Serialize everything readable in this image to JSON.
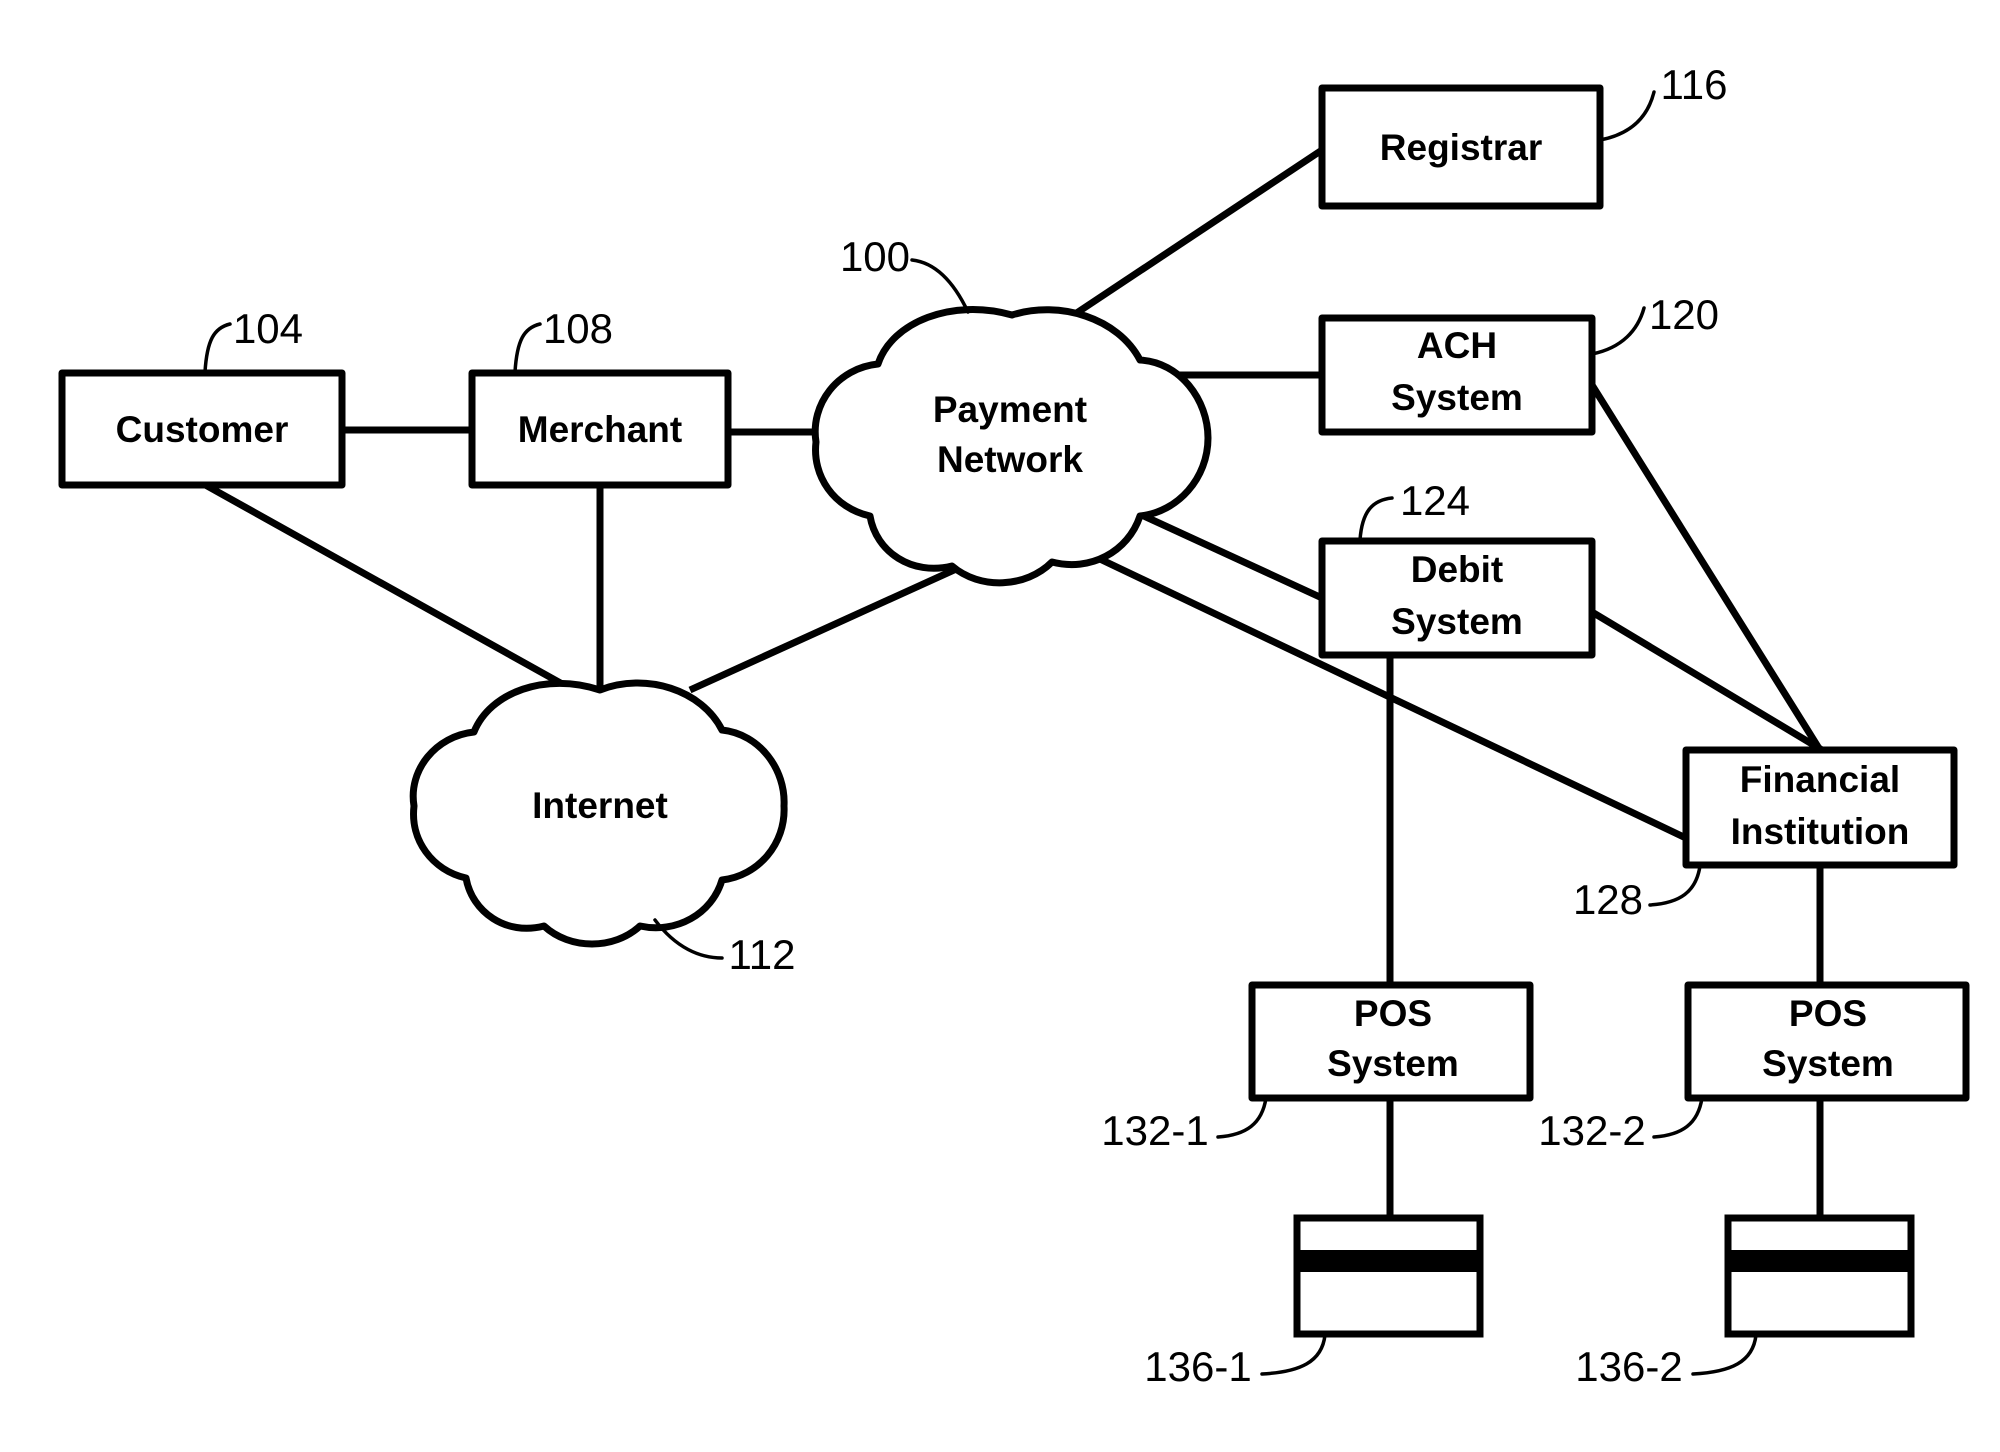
{
  "figure": {
    "title": "Payment network system block diagram",
    "background_color": "#ffffff",
    "line_color": "#000000"
  },
  "nodes": [
    {
      "id": "customer",
      "label": "Customer",
      "shape": "rect",
      "ref": "104"
    },
    {
      "id": "merchant",
      "label": "Merchant",
      "shape": "rect",
      "ref": "108"
    },
    {
      "id": "payment_network",
      "label_line1": "Payment",
      "label_line2": "Network",
      "shape": "cloud",
      "ref": "100"
    },
    {
      "id": "internet",
      "label": "Internet",
      "shape": "cloud",
      "ref": "112"
    },
    {
      "id": "registrar",
      "label": "Registrar",
      "shape": "rect",
      "ref": "116"
    },
    {
      "id": "ach_system",
      "label_line1": "ACH",
      "label_line2": "System",
      "shape": "rect",
      "ref": "120"
    },
    {
      "id": "debit_system",
      "label_line1": "Debit",
      "label_line2": "System",
      "shape": "rect",
      "ref": "124"
    },
    {
      "id": "financial_institution",
      "label_line1": "Financial",
      "label_line2": "Institution",
      "shape": "rect",
      "ref": "128"
    },
    {
      "id": "pos_system_1",
      "label_line1": "POS",
      "label_line2": "System",
      "shape": "rect",
      "ref": "132-1"
    },
    {
      "id": "pos_system_2",
      "label_line1": "POS",
      "label_line2": "System",
      "shape": "rect",
      "ref": "132-2"
    },
    {
      "id": "card_1",
      "label": "",
      "shape": "card",
      "ref": "136-1"
    },
    {
      "id": "card_2",
      "label": "",
      "shape": "card",
      "ref": "136-2"
    }
  ],
  "labels": {
    "customer": "Customer",
    "merchant": "Merchant",
    "payment_network_1": "Payment",
    "payment_network_2": "Network",
    "internet": "Internet",
    "registrar": "Registrar",
    "ach_1": "ACH",
    "ach_2": "System",
    "debit_1": "Debit",
    "debit_2": "System",
    "fi_1": "Financial",
    "fi_2": "Institution",
    "pos1_1": "POS",
    "pos1_2": "System",
    "pos2_1": "POS",
    "pos2_2": "System"
  },
  "refs": {
    "payment_network": "100",
    "customer": "104",
    "merchant": "108",
    "internet": "112",
    "registrar": "116",
    "ach_system": "120",
    "debit_system": "124",
    "financial_institution": "128",
    "pos_system_1": "132-1",
    "pos_system_2": "132-2",
    "card_1": "136-1",
    "card_2": "136-2"
  },
  "connections": [
    {
      "from": "customer",
      "to": "merchant"
    },
    {
      "from": "customer",
      "to": "internet"
    },
    {
      "from": "merchant",
      "to": "internet"
    },
    {
      "from": "merchant",
      "to": "payment_network"
    },
    {
      "from": "internet",
      "to": "payment_network"
    },
    {
      "from": "payment_network",
      "to": "registrar"
    },
    {
      "from": "payment_network",
      "to": "ach_system"
    },
    {
      "from": "payment_network",
      "to": "debit_system"
    },
    {
      "from": "payment_network",
      "to": "financial_institution"
    },
    {
      "from": "ach_system",
      "to": "financial_institution"
    },
    {
      "from": "debit_system",
      "to": "financial_institution"
    },
    {
      "from": "debit_system",
      "to": "pos_system_1"
    },
    {
      "from": "financial_institution",
      "to": "pos_system_2"
    },
    {
      "from": "pos_system_1",
      "to": "card_1"
    },
    {
      "from": "pos_system_2",
      "to": "card_2"
    }
  ]
}
